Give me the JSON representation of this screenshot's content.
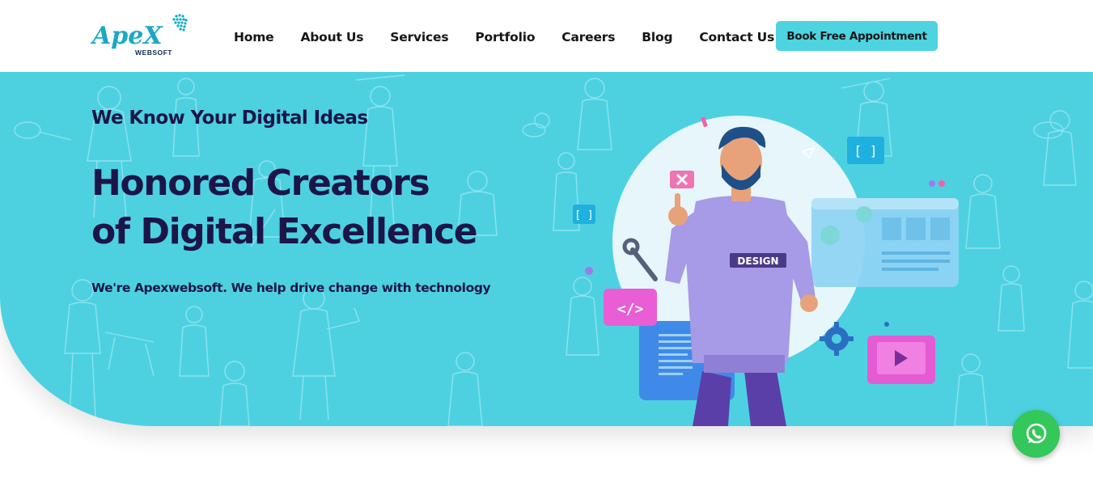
{
  "header": {
    "logo": {
      "brand": "ApeX",
      "sub": "WEBSOFT",
      "icon": "apex-websoft-logo"
    },
    "nav": [
      {
        "label": "Home",
        "name": "nav-home"
      },
      {
        "label": "About Us",
        "name": "nav-about-us"
      },
      {
        "label": "Services",
        "name": "nav-services"
      },
      {
        "label": "Portfolio",
        "name": "nav-portfolio"
      },
      {
        "label": "Careers",
        "name": "nav-careers"
      },
      {
        "label": "Blog",
        "name": "nav-blog"
      },
      {
        "label": "Contact Us",
        "name": "nav-contact-us"
      }
    ],
    "cta_label": "Book Free Appointment"
  },
  "hero": {
    "kicker": "We Know Your Digital Ideas",
    "headline_line1": "Honored Creators",
    "headline_line2": "of Digital Excellence",
    "tagline": "We're Apexwebsoft. We help drive change with technology",
    "illustration": {
      "badge_text": "DESIGN",
      "icons": [
        "close-icon",
        "code-icon",
        "play-icon",
        "gear-icon",
        "wrench-icon",
        "bracket-icon"
      ]
    }
  },
  "floating": {
    "whatsapp_icon": "whatsapp-icon"
  },
  "colors": {
    "accent": "#4ed3e0",
    "hero_bg": "#4dd1e1",
    "text_dark": "#1b1548",
    "whatsapp": "#34c759"
  }
}
